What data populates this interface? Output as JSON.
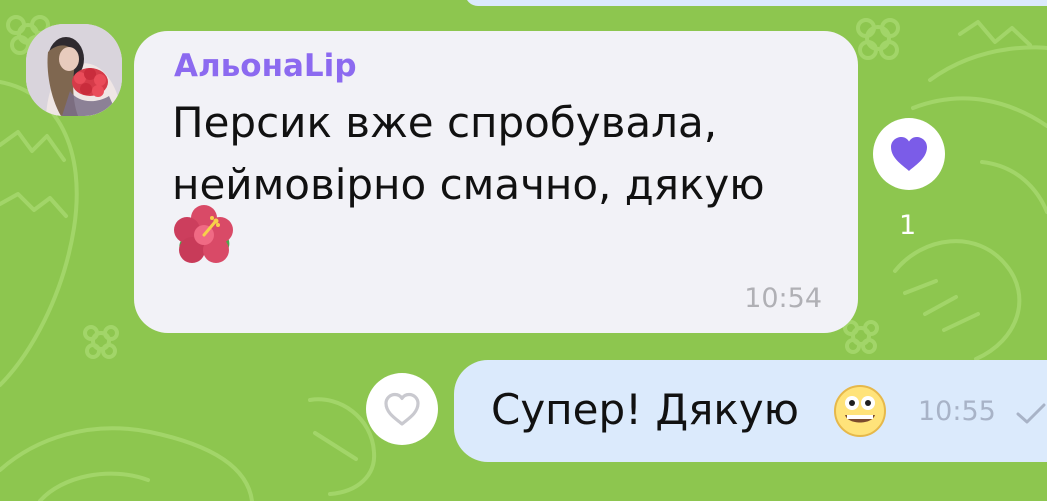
{
  "chat": {
    "incoming": {
      "sender": "АльонаLip",
      "text": "Персик вже спробувала, неймовірно смачно, дякую",
      "emoji": "hibiscus",
      "time": "10:54",
      "reaction": {
        "icon": "heart-icon",
        "count": "1",
        "color": "#7b5ce8"
      }
    },
    "outgoing": {
      "text": "Супер! Дякую",
      "emoji": "grinning-face",
      "time": "10:55",
      "status_icon": "single-check-icon"
    },
    "colors": {
      "wallpaper": "#8dc64f",
      "incoming_bubble": "#f2f2f7",
      "outgoing_bubble": "#dbeafc",
      "sender_name": "#8c6af0",
      "reaction_heart": "#7b5ce8"
    }
  }
}
